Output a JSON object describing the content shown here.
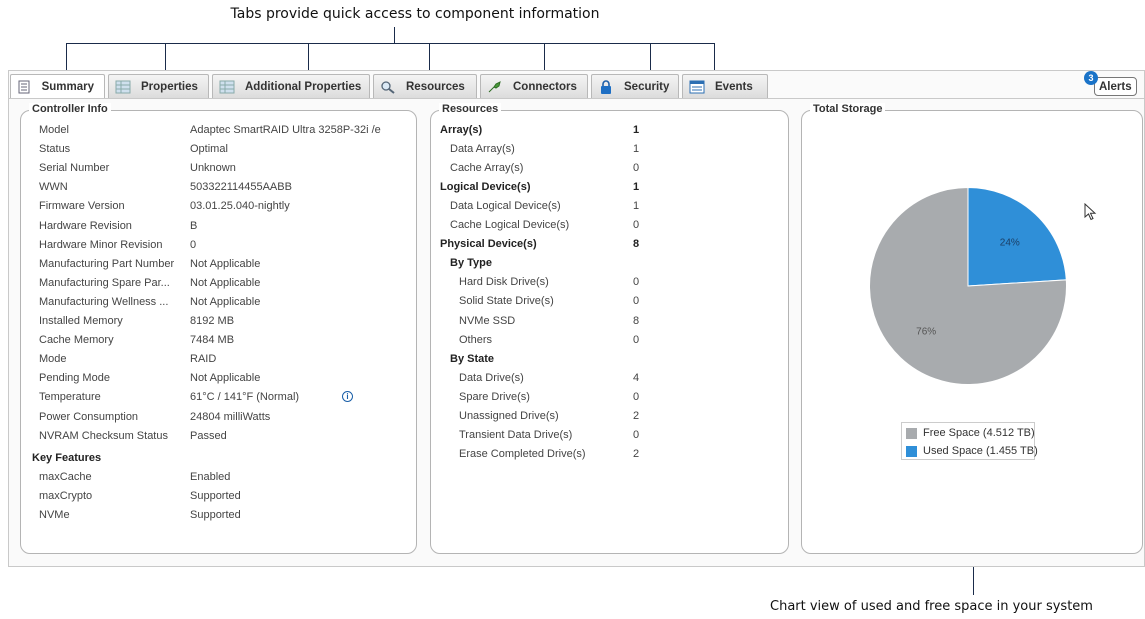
{
  "annotations": {
    "top": "Tabs provide quick access to component information",
    "bottom": "Chart view of used and free space in your system"
  },
  "tabs": [
    {
      "label": "Summary",
      "icon": "document-icon",
      "active": true
    },
    {
      "label": "Properties",
      "icon": "table-icon"
    },
    {
      "label": "Additional Properties",
      "icon": "table-icon"
    },
    {
      "label": "Resources",
      "icon": "magnifier-icon"
    },
    {
      "label": "Connectors",
      "icon": "plug-icon"
    },
    {
      "label": "Security",
      "icon": "lock-icon"
    },
    {
      "label": "Events",
      "icon": "event-log-icon"
    }
  ],
  "alerts": {
    "label": "Alerts",
    "count": "3"
  },
  "controller_info": {
    "title": "Controller Info",
    "rows": [
      {
        "label": "Model",
        "value": "Adaptec SmartRAID Ultra 3258P-32i /e"
      },
      {
        "label": "Status",
        "value": "Optimal"
      },
      {
        "label": "Serial Number",
        "value": "Unknown"
      },
      {
        "label": "WWN",
        "value": "503322114455AABB"
      },
      {
        "label": "Firmware Version",
        "value": "03.01.25.040-nightly"
      },
      {
        "label": "Hardware Revision",
        "value": "B"
      },
      {
        "label": "Hardware Minor Revision",
        "value": "0"
      },
      {
        "label": "Manufacturing Part Number",
        "value": "Not Applicable"
      },
      {
        "label": "Manufacturing Spare Par...",
        "value": "Not Applicable"
      },
      {
        "label": "Manufacturing Wellness ...",
        "value": "Not Applicable"
      },
      {
        "label": "Installed Memory",
        "value": "8192 MB"
      },
      {
        "label": "Cache Memory",
        "value": "7484 MB"
      },
      {
        "label": "Mode",
        "value": "RAID"
      },
      {
        "label": "Pending Mode",
        "value": "Not Applicable"
      },
      {
        "label": "Temperature",
        "value": "61°C / 141°F (Normal)"
      },
      {
        "label": "Power Consumption",
        "value": "24804 milliWatts"
      },
      {
        "label": "NVRAM Checksum Status",
        "value": "Passed"
      }
    ],
    "key_features_title": "Key Features",
    "key_features": [
      {
        "label": "maxCache",
        "value": "Enabled"
      },
      {
        "label": "maxCrypto",
        "value": "Supported"
      },
      {
        "label": "NVMe",
        "value": "Supported"
      }
    ]
  },
  "resources": {
    "title": "Resources",
    "rows": [
      {
        "label": "Array(s)",
        "value": "1",
        "level": "header"
      },
      {
        "label": "Data Array(s)",
        "value": "1",
        "level": "sub"
      },
      {
        "label": "Cache Array(s)",
        "value": "0",
        "level": "sub"
      },
      {
        "label": "Logical Device(s)",
        "value": "1",
        "level": "header"
      },
      {
        "label": "Data Logical Device(s)",
        "value": "1",
        "level": "sub"
      },
      {
        "label": "Cache Logical Device(s)",
        "value": "0",
        "level": "sub"
      },
      {
        "label": "Physical Device(s)",
        "value": "8",
        "level": "header"
      },
      {
        "label": "By Type",
        "value": "",
        "level": "group"
      },
      {
        "label": "Hard Disk Drive(s)",
        "value": "0",
        "level": "subsub"
      },
      {
        "label": "Solid State Drive(s)",
        "value": "0",
        "level": "subsub"
      },
      {
        "label": "NVMe SSD",
        "value": "8",
        "level": "subsub"
      },
      {
        "label": "Others",
        "value": "0",
        "level": "subsub"
      },
      {
        "label": "By State",
        "value": "",
        "level": "group"
      },
      {
        "label": "Data Drive(s)",
        "value": "4",
        "level": "subsub"
      },
      {
        "label": "Spare Drive(s)",
        "value": "0",
        "level": "subsub"
      },
      {
        "label": "Unassigned Drive(s)",
        "value": "2",
        "level": "subsub"
      },
      {
        "label": "Transient Data Drive(s)",
        "value": "0",
        "level": "subsub"
      },
      {
        "label": "Erase Completed Drive(s)",
        "value": "2",
        "level": "subsub"
      }
    ]
  },
  "total_storage": {
    "title": "Total Storage",
    "slices": [
      {
        "label": "76%",
        "fraction": 0.76,
        "color": "#a8abae"
      },
      {
        "label": "24%",
        "fraction": 0.24,
        "color": "#2f8fd8"
      }
    ],
    "legend": [
      {
        "label": "Free Space (4.512 TB)",
        "color": "#a8abae"
      },
      {
        "label": "Used Space (1.455 TB)",
        "color": "#2f8fd8"
      }
    ]
  },
  "colors": {
    "accent": "#2f8fd8",
    "free": "#a8abae",
    "badge": "#1a73c8"
  }
}
